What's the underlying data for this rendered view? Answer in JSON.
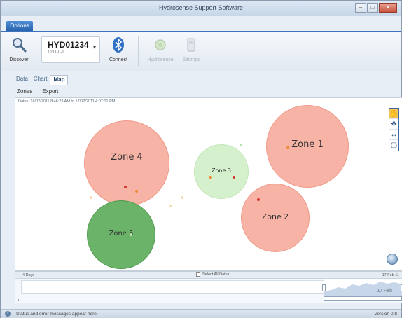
{
  "window": {
    "title": "Hydrosense Support Software",
    "controls": {
      "minimize": "–",
      "maximize": "□",
      "close": "✕"
    }
  },
  "menu": {
    "options_label": "Options"
  },
  "ribbon": {
    "discover_label": "Discover",
    "device_name": "HYD01234",
    "device_sub": "1211-0-1",
    "connect_label": "Connect",
    "disabled1_label": "Hydrosense",
    "disabled2_label": "Settings"
  },
  "view_tabs": [
    "Data",
    "Chart",
    "Map"
  ],
  "active_tab": "Map",
  "toolbar": {
    "zones_label": "Zones",
    "export_label": "Export"
  },
  "map": {
    "dates_text": "Dates: 16/02/2011 8:46:23 AM to 17/02/2011 4:07:01 PM",
    "zones": {
      "zone4": "Zone 4",
      "zone3": "Zone 3",
      "zone1": "Zone 1",
      "zone2": "Zone 2",
      "zone5": "Zone 5"
    },
    "colors": {
      "red_zone": "#f7b3a6",
      "light_green_zone": "#d4f0cc",
      "dark_green_zone": "#6cb36a",
      "marker_red": "#d9362c"
    }
  },
  "map_tools": [
    "hand-icon",
    "pan-icon",
    "resize-icon",
    "select-box-icon"
  ],
  "timeline": {
    "left_label": "4 Days",
    "select_all_label": "Select All Dates",
    "right_label": "17 Feb 11",
    "selected_date": "17 Feb"
  },
  "status": {
    "message": "Status and error messages appear here.",
    "version": "Version 0.8"
  }
}
